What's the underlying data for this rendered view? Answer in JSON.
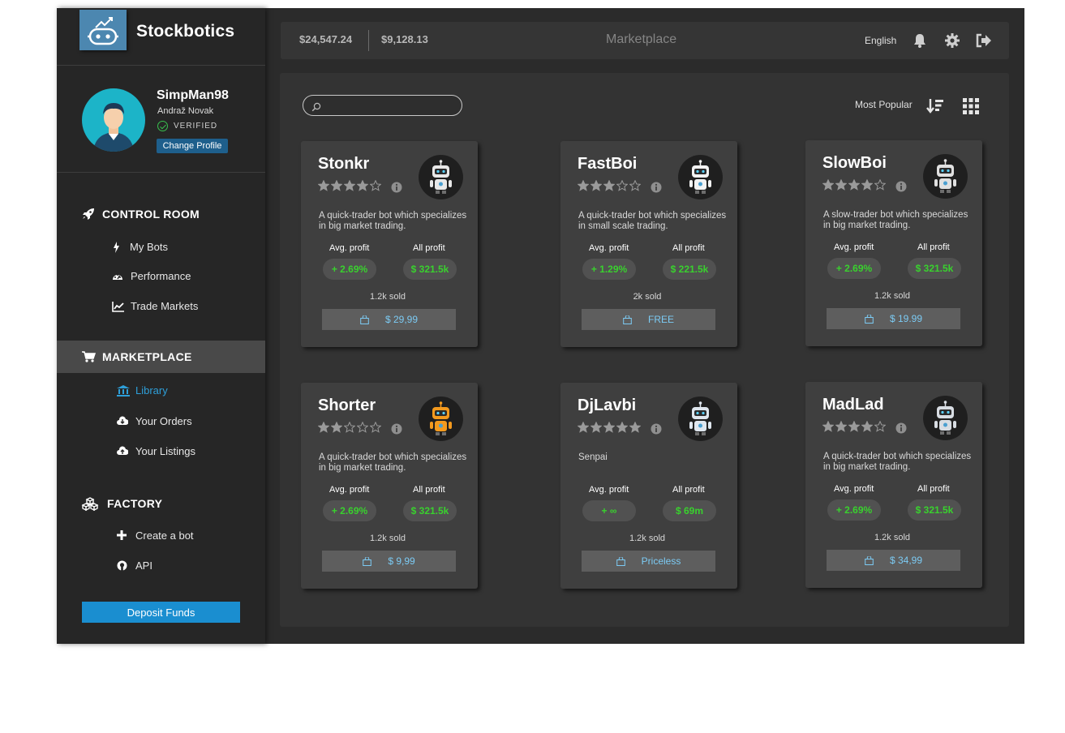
{
  "brand": {
    "name": "Stockbotics"
  },
  "profile": {
    "username": "SimpMan98",
    "full_name": "Andraž Novak",
    "verified_label": "VERIFIED",
    "change_profile_label": "Change Profile"
  },
  "sidebar": {
    "sections": [
      {
        "label": "CONTROL ROOM",
        "icon": "rocket-icon",
        "items": [
          {
            "label": "My Bots",
            "icon": "bolt-icon"
          },
          {
            "label": "Performance",
            "icon": "dashboard-icon"
          },
          {
            "label": "Trade Markets",
            "icon": "line-chart-icon"
          }
        ]
      },
      {
        "label": "MARKETPLACE",
        "icon": "cart-icon",
        "active": true,
        "items": [
          {
            "label": "Library",
            "icon": "bank-icon",
            "selected": true
          },
          {
            "label": "Your Orders",
            "icon": "cloud-download-icon"
          },
          {
            "label": "Your Listings",
            "icon": "cloud-upload-icon"
          }
        ]
      },
      {
        "label": "FACTORY",
        "icon": "cubes-icon",
        "items": [
          {
            "label": "Create a bot",
            "icon": "plus-icon"
          },
          {
            "label": "API",
            "icon": "github-icon"
          }
        ]
      }
    ],
    "deposit_label": "Deposit Funds"
  },
  "header": {
    "balance_primary": "$24,547.24",
    "balance_secondary": "$9,128.13",
    "title": "Marketplace",
    "language": "English",
    "icons": [
      "bell-icon",
      "gear-icon",
      "sign-out-icon"
    ]
  },
  "toolbar": {
    "search_placeholder": "",
    "sort_label": "Most Popular",
    "icons": [
      "search-icon",
      "sort-desc-icon",
      "grid-view-icon"
    ]
  },
  "labels": {
    "avg_profit": "Avg. profit",
    "all_profit": "All profit"
  },
  "colors": {
    "accent": "#1a8ed0",
    "profit": "#39d12e",
    "price": "#7ccbf4",
    "avatar_bg": "#1cb4c8",
    "logo_bg": "#4c87b0"
  },
  "cards": [
    {
      "name": "Stonkr",
      "rating": 4,
      "description": "A quick-trader bot which specializes in big market trading.",
      "avg_profit": "+ 2.69%",
      "all_profit": "$ 321.5k",
      "sold": "1.2k sold",
      "price": "$ 29,99",
      "bot_color": "#e8e8e8"
    },
    {
      "name": "FastBoi",
      "rating": 3,
      "description": "A quick-trader bot which specializes in small scale trading.",
      "avg_profit": "+ 1.29%",
      "all_profit": "$ 221.5k",
      "sold": "2k sold",
      "price": "FREE",
      "bot_color": "#f2f2f2"
    },
    {
      "name": "SlowBoi",
      "rating": 4,
      "description": "A slow-trader bot which specializes in big market trading.",
      "avg_profit": "+ 2.69%",
      "all_profit": "$ 321.5k",
      "sold": "1.2k sold",
      "price": "$ 19.99",
      "bot_color": "#e0e0e0"
    },
    {
      "name": "Shorter",
      "rating": 2,
      "description": "A quick-trader bot which specializes in big market trading.",
      "avg_profit": "+ 2.69%",
      "all_profit": "$ 321.5k",
      "sold": "1.2k sold",
      "price": "$ 9,99",
      "bot_color": "#f39a1e"
    },
    {
      "name": "DjLavbi",
      "rating": 5,
      "description": "Senpai",
      "avg_profit": "+ ∞",
      "all_profit": "$ 69m",
      "sold": "1.2k sold",
      "price": "Priceless",
      "bot_color": "#dfe6ee"
    },
    {
      "name": "MadLad",
      "rating": 4,
      "description": "A quick-trader bot which specializes in big market trading.",
      "avg_profit": "+ 2.69%",
      "all_profit": "$ 321.5k",
      "sold": "1.2k sold",
      "price": "$ 34,99",
      "bot_color": "#d8dde3"
    }
  ]
}
